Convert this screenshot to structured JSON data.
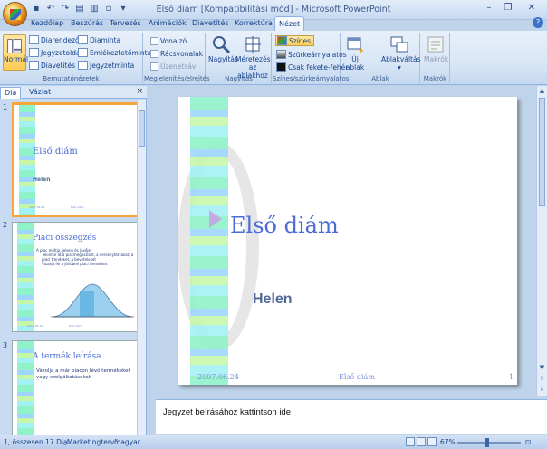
{
  "window": {
    "title": "Első diám [Kompatibilitási mód] - Microsoft PowerPoint"
  },
  "quick_access": [
    "save-icon",
    "undo-icon",
    "redo-icon",
    "open-icon",
    "print-icon",
    "new-icon"
  ],
  "tabs": [
    {
      "label": "Kezdőlap"
    },
    {
      "label": "Beszúrás"
    },
    {
      "label": "Tervezés"
    },
    {
      "label": "Animációk"
    },
    {
      "label": "Diavetítés"
    },
    {
      "label": "Korrektúra"
    },
    {
      "label": "Nézet",
      "active": true
    }
  ],
  "ribbon": {
    "bemutato": {
      "label": "Bemutatónézetek",
      "normal": "Normál",
      "diarendezo": "Diarendező",
      "jegyzetoldal": "Jegyzetoldal",
      "diavetites": "Diavetítés",
      "diaminta": "Diaminta",
      "emlekezteto": "Emlékeztetőminta",
      "jegyzetminta": "Jegyzetminta"
    },
    "megjelenites": {
      "label": "Megjelenítés/elrejtés",
      "vonalzo": "Vonalzó",
      "racsvonalak": "Rácsvonalak",
      "uzenetsav": "Üzenetsáv"
    },
    "nagyitas": {
      "label": "Nagyítás",
      "nagyitas_btn": "Nagyítás",
      "meretezes_line1": "Méretezés",
      "meretezes_line2": "az ablakhoz"
    },
    "szines": {
      "label": "Színes/szürkeárnyalatos",
      "szines": "Színes",
      "szurke": "Szürkeárnyalatos",
      "fekete": "Csak fekete-fehér"
    },
    "ablak": {
      "label": "Ablak",
      "uj_line1": "Új",
      "uj_line2": "ablak",
      "ablakvaltas": "Ablakváltás"
    },
    "makrok": {
      "label": "Makrók",
      "makrok": "Makrók"
    }
  },
  "left_pane": {
    "tab_dia": "Dia",
    "tab_vazlat": "Vázlat",
    "close": "×",
    "slides": [
      {
        "num": "1",
        "title": "Első diám",
        "subtitle": "Helen",
        "footer_left": "2007.06.24",
        "footer_mid": "Első diám"
      },
      {
        "num": "2",
        "title": "Piaci összegzés",
        "bullets": [
          "A piac múltja, jelene és jövője",
          "Tekintse át a piacmegoszlást, a versenytársakat, a piaci trendeket, a bevételeket",
          "Vázolja fel a jövőbeli piaci trendeket"
        ],
        "footer_left": "2007.06.24",
        "footer_mid": "Első diám"
      },
      {
        "num": "3",
        "title": "A termék leírása",
        "bullets": [
          "Vázolja a már piacon lévő termékeket vagy szolgáltatásokat"
        ]
      }
    ]
  },
  "main_slide": {
    "title": "Első diám",
    "subtitle": "Helen",
    "footer_date": "2007.06.24",
    "footer_title": "Első diám",
    "footer_page": "1"
  },
  "notes": {
    "placeholder": "Jegyzet beírásához kattintson ide"
  },
  "status": {
    "slide_info": "1, összesen 17 Dia",
    "theme": "„Marketingterv”",
    "language": "magyar",
    "zoom": "67%"
  },
  "colors": {
    "title_blue": "#4b6bd6",
    "selected_border": "#f7a43b",
    "ribbon_bg": "#d9e6f6"
  }
}
